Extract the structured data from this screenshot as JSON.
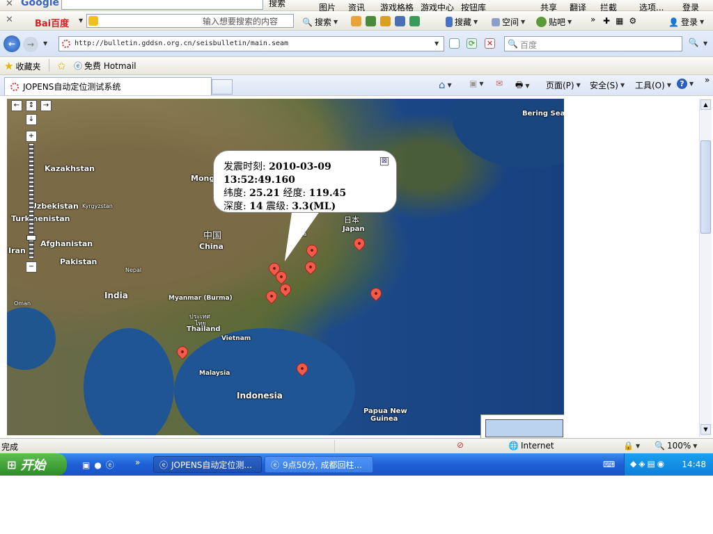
{
  "google": {
    "logo": "Google",
    "search": "搜索",
    "links": [
      "图片",
      "资讯",
      "游戏格格",
      "游戏中心",
      "按钮库",
      "共享",
      "翻译",
      "拦截",
      "选项...",
      "登录"
    ]
  },
  "baidu": {
    "logo": "Bai百度",
    "placeholder": "输入想要搜索的内容",
    "search": "搜索",
    "items": [
      "搜藏",
      "空间",
      "贴吧",
      "登录"
    ],
    "more": "»"
  },
  "nav": {
    "url": "http://bulletin.gddsn.org.cn/seisbulletin/main.seam",
    "search_placeholder": "百度"
  },
  "favorites": {
    "label": "收藏夹",
    "items": [
      "免费 Hotmail"
    ]
  },
  "tabs": {
    "active": "JOPENS自动定位测试系统",
    "tools": [
      "页面(P)",
      "安全(S)",
      "工具(O)"
    ],
    "more": "»"
  },
  "map": {
    "labels": [
      "Bering Sea",
      "Kazakhstan",
      "Mong",
      "Uzbekistan",
      "Kyrgyzstan",
      "Turkmenistan",
      "Afghanistan",
      "Iran",
      "Pakistan",
      "中国",
      "China",
      "Nepal",
      "India",
      "Oman",
      "Myanmar (Burma)",
      "ประเทศ",
      "ไทย",
      "Thailand",
      "Vietnam",
      "Malaysia",
      "Indonesia",
      "日本",
      "Japan",
      "Papua New",
      "Guinea",
      "cea"
    ],
    "popup": {
      "time_label": "发震时刻:",
      "time": "2010-03-09 13:52:49.160",
      "lat_label": "纬度:",
      "lat": "25.21",
      "lon_label": "经度:",
      "lon": "119.45",
      "depth_label": "深度:",
      "depth": "14",
      "mag_label": "震级:",
      "mag": "3.3(ML)",
      "close": "⊠"
    },
    "controls": {
      "zoom_in": "+",
      "zoom_out": "−",
      "left": "←",
      "right": "→",
      "up": "↕",
      "down": "↓"
    }
  },
  "status": {
    "text": "完成",
    "zone": "Internet",
    "zoom": "100%"
  },
  "taskbar": {
    "start": "开始",
    "tasks": [
      "JOPENS自动定位测...",
      "9点50分, 成都回柱..."
    ],
    "time": "14:48",
    "more": "»"
  }
}
